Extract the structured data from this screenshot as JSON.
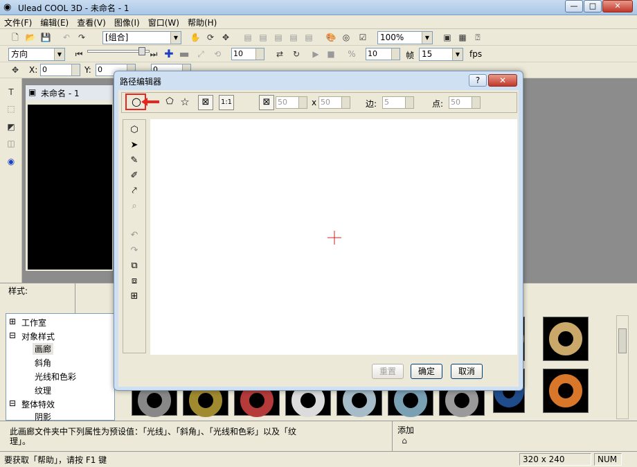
{
  "app": {
    "title": "Ulead COOL 3D - 未命名 - 1",
    "minimize": "—",
    "maximize": "□",
    "close": "✕"
  },
  "menu": [
    "文件(F)",
    "编辑(E)",
    "查看(V)",
    "图像(I)",
    "窗口(W)",
    "帮助(H)"
  ],
  "toolbar1": {
    "object_combo": "[组合]",
    "zoom_combo": "100%"
  },
  "toolbar2": {
    "direction_combo": "方向",
    "frame_value": "10",
    "frames_value": "10",
    "frame_label": "帧",
    "fps_combo": "15",
    "fps_label": "fps"
  },
  "toolbar3": {
    "x_label": "X:",
    "x_value": "0",
    "y_label": "Y:",
    "y_value": "0",
    "z_value": "0"
  },
  "document": {
    "title": "未命名 - 1"
  },
  "style_panel": {
    "label": "样式:"
  },
  "tree": {
    "items": [
      {
        "label": "工作室",
        "expander": "⊞"
      },
      {
        "label": "对象样式",
        "expander": "⊟"
      },
      {
        "label": "画廊"
      },
      {
        "label": "斜角"
      },
      {
        "label": "光线和色彩"
      },
      {
        "label": "纹理"
      },
      {
        "label": "整体特效",
        "expander": "⊟"
      },
      {
        "label": "阴影"
      }
    ]
  },
  "description": {
    "text_line1": "此画廊文件夹中下列属性为预设值：「光线」、「斜角」、「光线和色彩」以及「纹",
    "text_line2": "理」。",
    "add_label": "添加"
  },
  "status": {
    "help_text": "要获取「帮助」，请按 F1 键",
    "size": "320 x 240",
    "num": "NUM"
  },
  "dialog": {
    "title": "路径编辑器",
    "help": "?",
    "close": "✕",
    "width_value": "50",
    "height_value": "50",
    "times": "x",
    "sides_label": "边:",
    "sides_value": "5",
    "points_label": "点:",
    "points_value": "50",
    "reset": "重置",
    "ok": "确定",
    "cancel": "取消"
  },
  "colors": {
    "highlight": "#e8251f",
    "crosshair": "#cc2222",
    "canvas": "#ffffff"
  }
}
